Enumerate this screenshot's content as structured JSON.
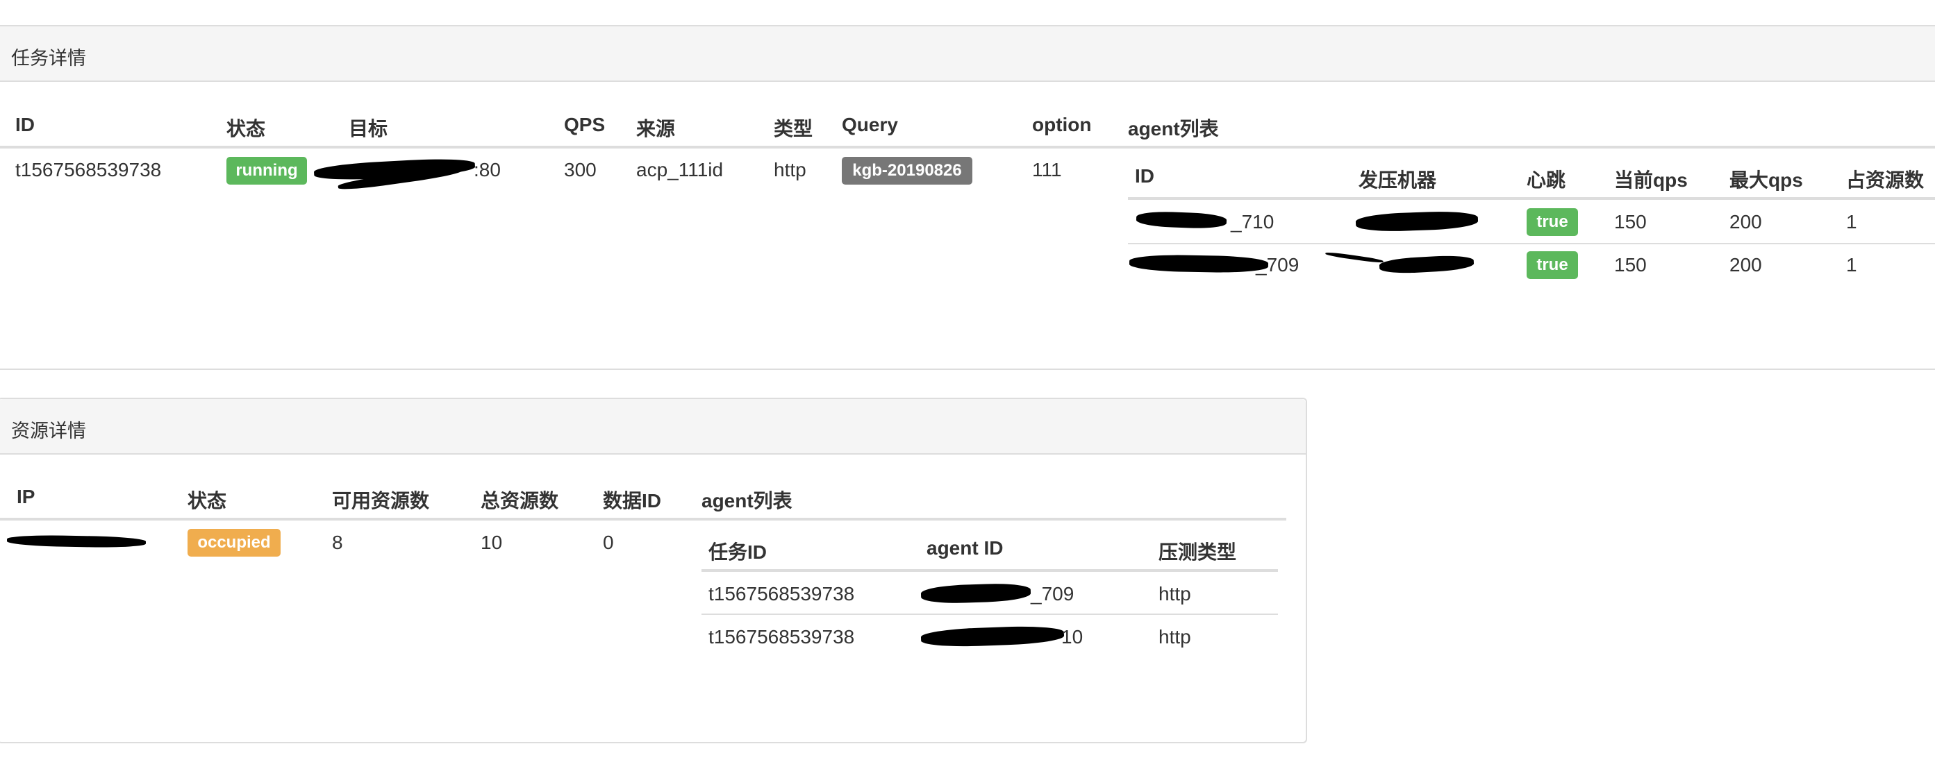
{
  "task_panel": {
    "title": "任务详情",
    "headers": {
      "id": "ID",
      "status": "状态",
      "target": "目标",
      "qps": "QPS",
      "source": "来源",
      "type": "类型",
      "query": "Query",
      "option": "option",
      "agent_list": "agent列表"
    },
    "row": {
      "id": "t1567568539738",
      "status": "running",
      "target_suffix": ":80",
      "qps": "300",
      "source": "acp_111id",
      "type": "http",
      "query": "kgb-20190826",
      "option": "111"
    },
    "agents": {
      "headers": {
        "id": "ID",
        "machine": "发压机器",
        "heartbeat": "心跳",
        "current_qps": "当前qps",
        "max_qps": "最大qps",
        "resources": "占资源数"
      },
      "rows": [
        {
          "id_suffix": "_710",
          "heartbeat": "true",
          "current_qps": "150",
          "max_qps": "200",
          "resources": "1"
        },
        {
          "id_suffix": "_709",
          "heartbeat": "true",
          "current_qps": "150",
          "max_qps": "200",
          "resources": "1"
        }
      ]
    }
  },
  "resource_panel": {
    "title": "资源详情",
    "headers": {
      "ip": "IP",
      "status": "状态",
      "available": "可用资源数",
      "total": "总资源数",
      "data_id": "数据ID",
      "agent_list": "agent列表"
    },
    "row": {
      "status": "occupied",
      "available": "8",
      "total": "10",
      "data_id": "0"
    },
    "agents": {
      "headers": {
        "task_id": "任务ID",
        "agent_id": "agent ID",
        "test_type": "压测类型"
      },
      "rows": [
        {
          "task_id": "t1567568539738",
          "agent_id_suffix": "_709",
          "test_type": "http"
        },
        {
          "task_id": "t1567568539738",
          "agent_id_suffix": "10",
          "test_type": "http"
        }
      ]
    }
  },
  "colors": {
    "success": "#5cb85c",
    "default": "#777777",
    "warning": "#f0ad4e",
    "border": "#dddddd",
    "heading_bg": "#f5f5f5"
  }
}
